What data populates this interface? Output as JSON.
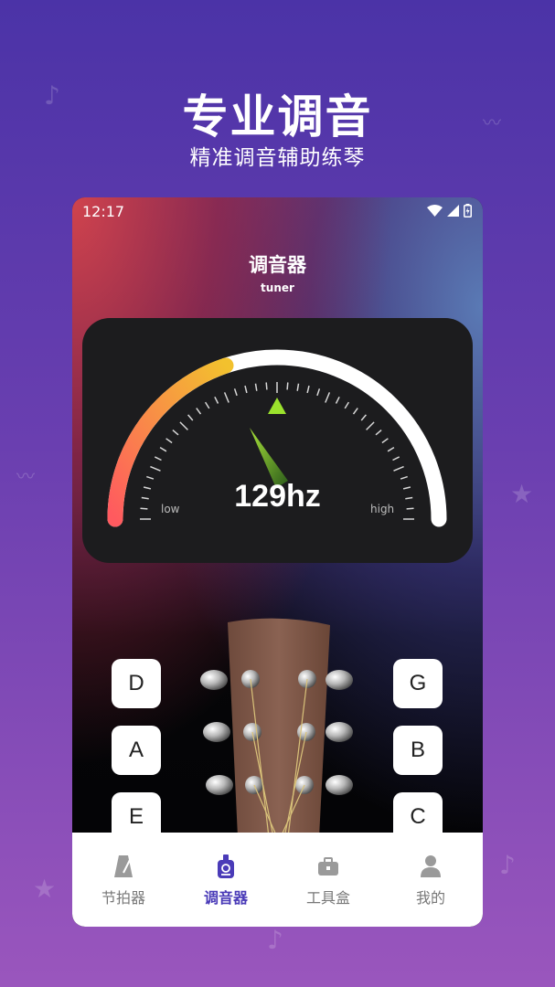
{
  "promo": {
    "title": "专业调音",
    "subtitle": "精准调音辅助练琴"
  },
  "status_bar": {
    "time": "12:17"
  },
  "app": {
    "title": "调音器",
    "subtitle": "tuner"
  },
  "gauge": {
    "frequency": "129hz",
    "low_label": "low",
    "high_label": "high",
    "colors": {
      "active_start": "#ff5a5f",
      "active_end": "#f2c12e",
      "track": "#ffffff",
      "pointer": "#9be22d"
    }
  },
  "strings": {
    "left": [
      "D",
      "A",
      "E"
    ],
    "right": [
      "G",
      "B",
      "C"
    ]
  },
  "tabbar": {
    "tabs": [
      {
        "label": "节拍器",
        "icon": "metronome-icon",
        "active": false
      },
      {
        "label": "调音器",
        "icon": "tuner-icon",
        "active": true
      },
      {
        "label": "工具盒",
        "icon": "toolbox-icon",
        "active": false
      },
      {
        "label": "我的",
        "icon": "user-icon",
        "active": false
      }
    ],
    "active_color": "#4a3bb8"
  }
}
